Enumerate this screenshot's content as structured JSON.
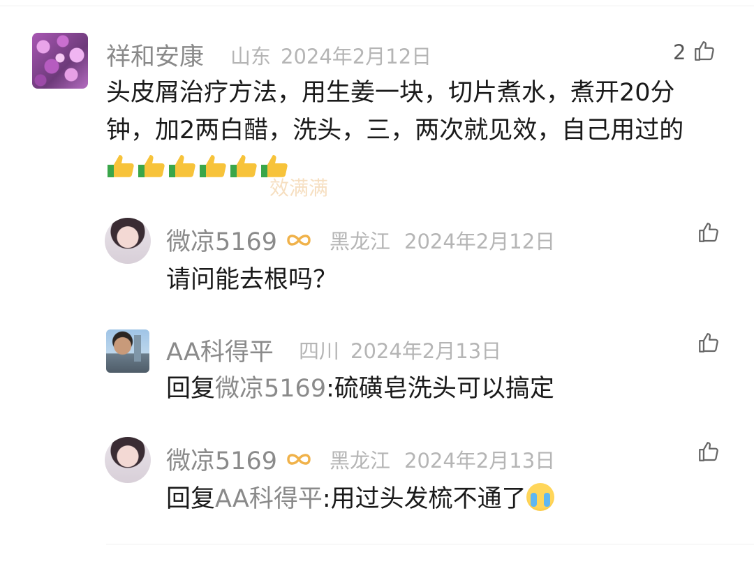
{
  "comments": [
    {
      "username": "祥和安康",
      "location": "山东",
      "date": "2024年2月12日",
      "like_count": "2",
      "text": "头皮屑治疗方法，用生姜一块，切片煮水，煮开20分钟，加2两白醋，洗头，三，两次就见效，自己用过的",
      "emoji": "thumbs-up x6"
    }
  ],
  "replies": [
    {
      "username": "微凉5169",
      "location": "黑龙江",
      "date": "2024年2月12日",
      "text": "请问能去根吗？",
      "has_badge": true
    },
    {
      "username": "AA科得平",
      "location": "四川",
      "date": "2024年2月13日",
      "reply_prefix": "回复",
      "reply_target": "微凉5169",
      "text": ":硫磺皂洗头可以搞定"
    },
    {
      "username": "微凉5169",
      "location": "黑龙江",
      "date": "2024年2月13日",
      "reply_prefix": "回复",
      "reply_target": "AA科得平",
      "text": ":用过头发梳不通了",
      "has_badge": true,
      "emoji": "sob-face"
    }
  ],
  "watermark": "效满满",
  "colors": {
    "name": "#8a8a8a",
    "meta": "#b5b5b5",
    "badge": "#f0b24a",
    "text": "#1a1a1a"
  }
}
